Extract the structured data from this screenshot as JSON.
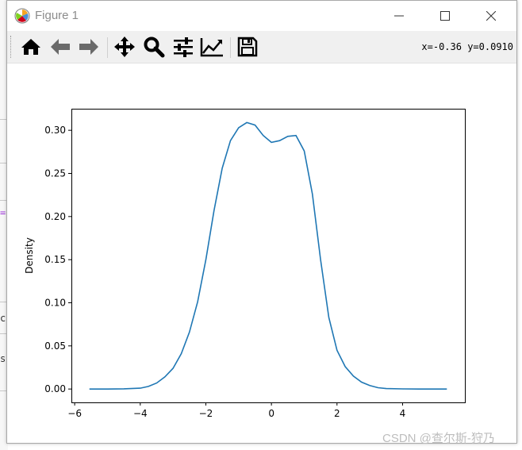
{
  "window": {
    "title": "Figure 1"
  },
  "toolbar": {
    "tools": [
      "home-icon",
      "back-arrow-icon",
      "forward-arrow-icon",
      "pan-icon",
      "zoom-icon",
      "configure-subplots-icon",
      "edit-axis-icon",
      "save-icon"
    ],
    "coordinates": "x=-0.36 y=0.0910"
  },
  "background": {
    "chars": [
      "=",
      "c",
      "s"
    ]
  },
  "watermark": "CSDN @查尔斯-狩乃",
  "chart_data": {
    "type": "line",
    "title": "",
    "xlabel": "",
    "ylabel": "Density",
    "xlim": [
      -6.1,
      5.9
    ],
    "ylim": [
      -0.0155,
      0.325
    ],
    "xticks": [
      -6,
      -4,
      -2,
      0,
      2,
      4
    ],
    "yticks": [
      0.0,
      0.05,
      0.1,
      0.15,
      0.2,
      0.25,
      0.3
    ],
    "xtick_labels": [
      "−6",
      "−4",
      "−2",
      "0",
      "2",
      "4"
    ],
    "ytick_labels": [
      "0.00",
      "0.05",
      "0.10",
      "0.15",
      "0.20",
      "0.25",
      "0.30"
    ],
    "grid": false,
    "line_color": "#1f77b4",
    "series": [
      {
        "x": [
          -5.55,
          -5.0,
          -4.5,
          -4.0,
          -3.75,
          -3.5,
          -3.25,
          -3.0,
          -2.75,
          -2.5,
          -2.25,
          -2.0,
          -1.75,
          -1.5,
          -1.25,
          -1.0,
          -0.75,
          -0.5,
          -0.25,
          0.0,
          0.25,
          0.5,
          0.75,
          1.0,
          1.25,
          1.5,
          1.75,
          2.0,
          2.25,
          2.5,
          2.75,
          3.0,
          3.25,
          3.5,
          4.0,
          4.5,
          5.0,
          5.35
        ],
        "y": [
          0.0,
          0.0,
          0.0002,
          0.001,
          0.003,
          0.007,
          0.014,
          0.024,
          0.041,
          0.066,
          0.101,
          0.15,
          0.207,
          0.256,
          0.288,
          0.303,
          0.309,
          0.306,
          0.294,
          0.286,
          0.288,
          0.293,
          0.294,
          0.276,
          0.226,
          0.15,
          0.083,
          0.045,
          0.026,
          0.015,
          0.008,
          0.004,
          0.0015,
          0.0005,
          0.0001,
          0.0,
          0.0,
          0.0
        ]
      }
    ]
  }
}
